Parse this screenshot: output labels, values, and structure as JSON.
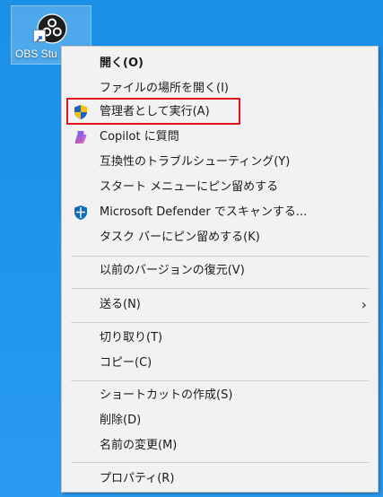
{
  "desktop": {
    "icon_label": "OBS Stu"
  },
  "menu": {
    "open": "開く(O)",
    "open_location": "ファイルの場所を開く(I)",
    "run_as_admin": "管理者として実行(A)",
    "copilot": "Copilot に質問",
    "troubleshoot": "互換性のトラブルシューティング(Y)",
    "pin_start": "スタート メニューにピン留めする",
    "defender": "Microsoft Defender でスキャンする...",
    "pin_taskbar": "タスク バーにピン留めする(K)",
    "restore_prev": "以前のバージョンの復元(V)",
    "send_to": "送る(N)",
    "cut": "切り取り(T)",
    "copy": "コピー(C)",
    "create_shortcut": "ショートカットの作成(S)",
    "delete": "削除(D)",
    "rename": "名前の変更(M)",
    "properties": "プロパティ(R)"
  },
  "colors": {
    "highlight": "#e0141e",
    "desktop_bg": "#1c8fe6",
    "menu_bg": "#f2f2f2"
  }
}
